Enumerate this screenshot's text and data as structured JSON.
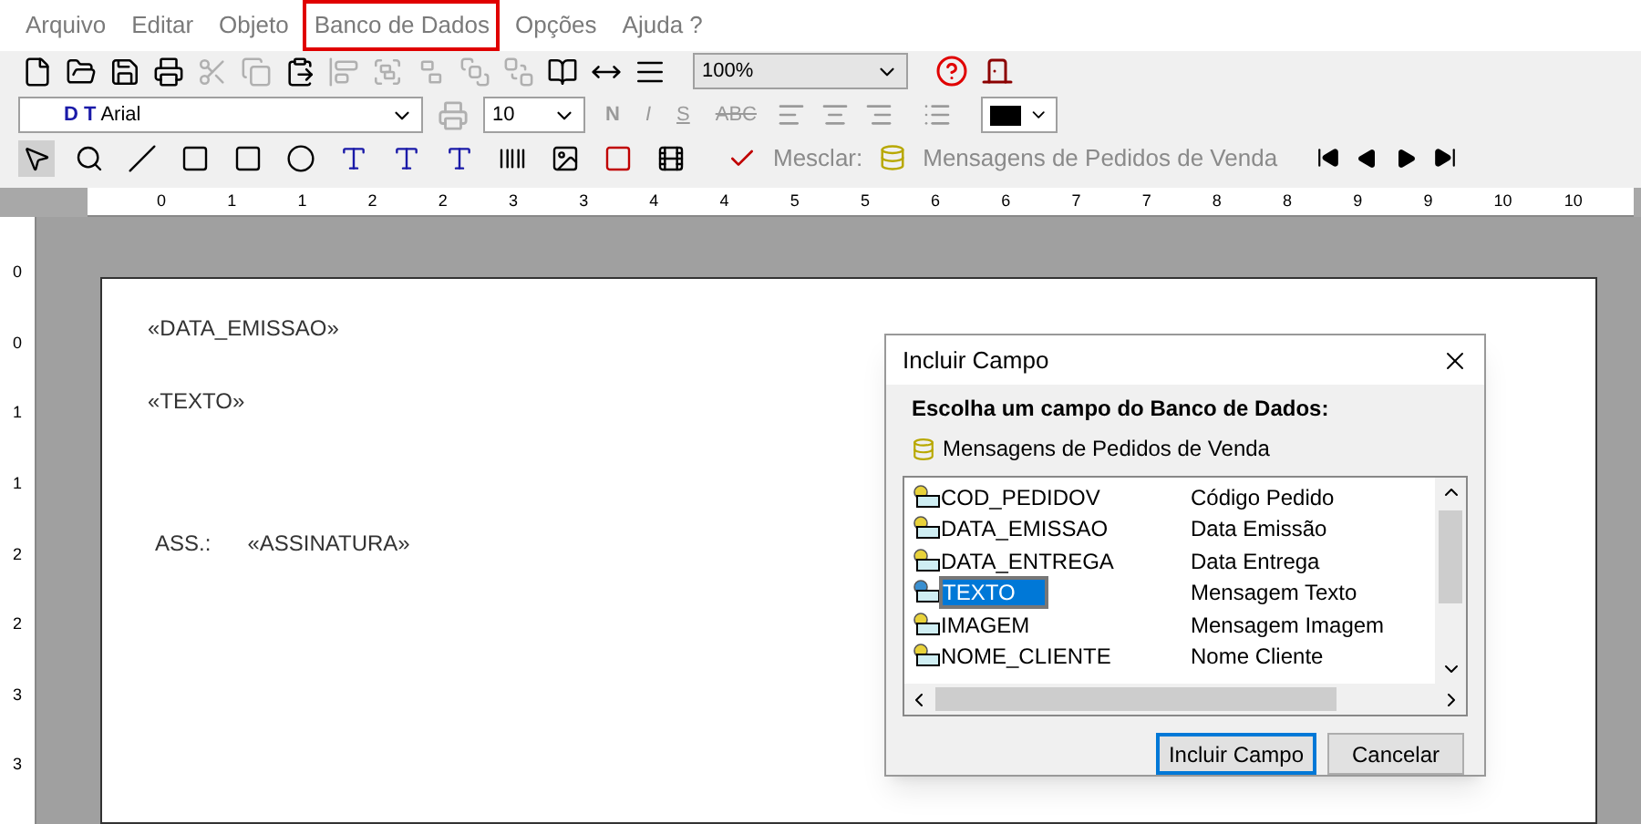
{
  "menu": [
    {
      "label": "Arquivo",
      "selected": false
    },
    {
      "label": "Editar",
      "selected": false
    },
    {
      "label": "Objeto",
      "selected": false
    },
    {
      "label": "Banco de Dados",
      "selected": true
    },
    {
      "label": "Opções",
      "selected": false
    },
    {
      "label": "Ajuda ?",
      "selected": false
    }
  ],
  "toolbar": [
    {
      "kind": "new",
      "disabled": false
    },
    {
      "kind": "open",
      "disabled": false
    },
    {
      "kind": "save",
      "disabled": false
    },
    {
      "kind": "print",
      "disabled": false
    },
    {
      "kind": "cut",
      "disabled": true
    },
    {
      "kind": "copy",
      "disabled": true
    },
    {
      "kind": "paste",
      "disabled": false
    },
    {
      "kind": "align",
      "disabled": true
    },
    {
      "kind": "group",
      "disabled": true
    },
    {
      "kind": "ungroup",
      "disabled": true
    },
    {
      "kind": "front",
      "disabled": true
    },
    {
      "kind": "back",
      "disabled": true
    },
    {
      "kind": "page",
      "disabled": false
    },
    {
      "kind": "width",
      "disabled": false
    },
    {
      "kind": "lines",
      "disabled": false
    }
  ],
  "zoom": {
    "value": "100%"
  },
  "format": {
    "font_prefix": "D T",
    "font": "Arial",
    "size": "10",
    "styles": [
      {
        "label": "N",
        "kind": "bold"
      },
      {
        "label": "I",
        "kind": "italic"
      },
      {
        "label": "S",
        "kind": "underline"
      },
      {
        "label": "ABC",
        "kind": "strike"
      }
    ],
    "color": "#000000"
  },
  "tools": [
    {
      "kind": "pointer",
      "selected": true
    },
    {
      "kind": "zoom",
      "selected": false
    },
    {
      "kind": "line",
      "selected": false
    },
    {
      "kind": "roundrect",
      "selected": false
    },
    {
      "kind": "rect",
      "selected": false
    },
    {
      "kind": "ellipse",
      "selected": false
    },
    {
      "kind": "textbox",
      "selected": false
    },
    {
      "kind": "richtext",
      "selected": false
    },
    {
      "kind": "text",
      "selected": false
    },
    {
      "kind": "barcode",
      "selected": false
    },
    {
      "kind": "image",
      "selected": false
    },
    {
      "kind": "ole",
      "selected": false
    },
    {
      "kind": "film",
      "selected": false
    }
  ],
  "merge": {
    "label": "Mesclar:",
    "source": "Mensagens de Pedidos de Venda"
  },
  "ruler_h": [
    "0",
    "1",
    "1",
    "2",
    "2",
    "3",
    "3",
    "4",
    "4",
    "5",
    "5",
    "6",
    "6",
    "7",
    "7",
    "8",
    "8",
    "9",
    "9",
    "10",
    "10"
  ],
  "ruler_v": [
    "0",
    "0",
    "1",
    "1",
    "2",
    "2",
    "3",
    "3"
  ],
  "document": [
    {
      "kind": "field",
      "text": "«DATA_EMISSAO»"
    },
    {
      "kind": "field",
      "text": "«TEXTO»"
    },
    {
      "kind": "labeled",
      "label": "ASS.:",
      "text": "«ASSINATURA»"
    }
  ],
  "dialog": {
    "title": "Incluir Campo",
    "heading": "Escolha um campo do Banco de Dados:",
    "source": "Mensagens de Pedidos de Venda",
    "fields": [
      {
        "name": "COD_PEDIDOV",
        "description": "Código Pedido",
        "selected": false
      },
      {
        "name": "DATA_EMISSAO",
        "description": "Data Emissão",
        "selected": false
      },
      {
        "name": "DATA_ENTREGA",
        "description": "Data Entrega",
        "selected": false
      },
      {
        "name": "TEXTO",
        "description": "Mensagem Texto",
        "selected": true
      },
      {
        "name": "IMAGEM",
        "description": "Mensagem Imagem",
        "selected": false
      },
      {
        "name": "NOME_CLIENTE",
        "description": "Nome Cliente",
        "selected": false
      }
    ],
    "buttons": [
      {
        "label": "Incluir Campo",
        "kind": "default"
      },
      {
        "label": "Cancelar",
        "kind": "normal"
      }
    ]
  }
}
